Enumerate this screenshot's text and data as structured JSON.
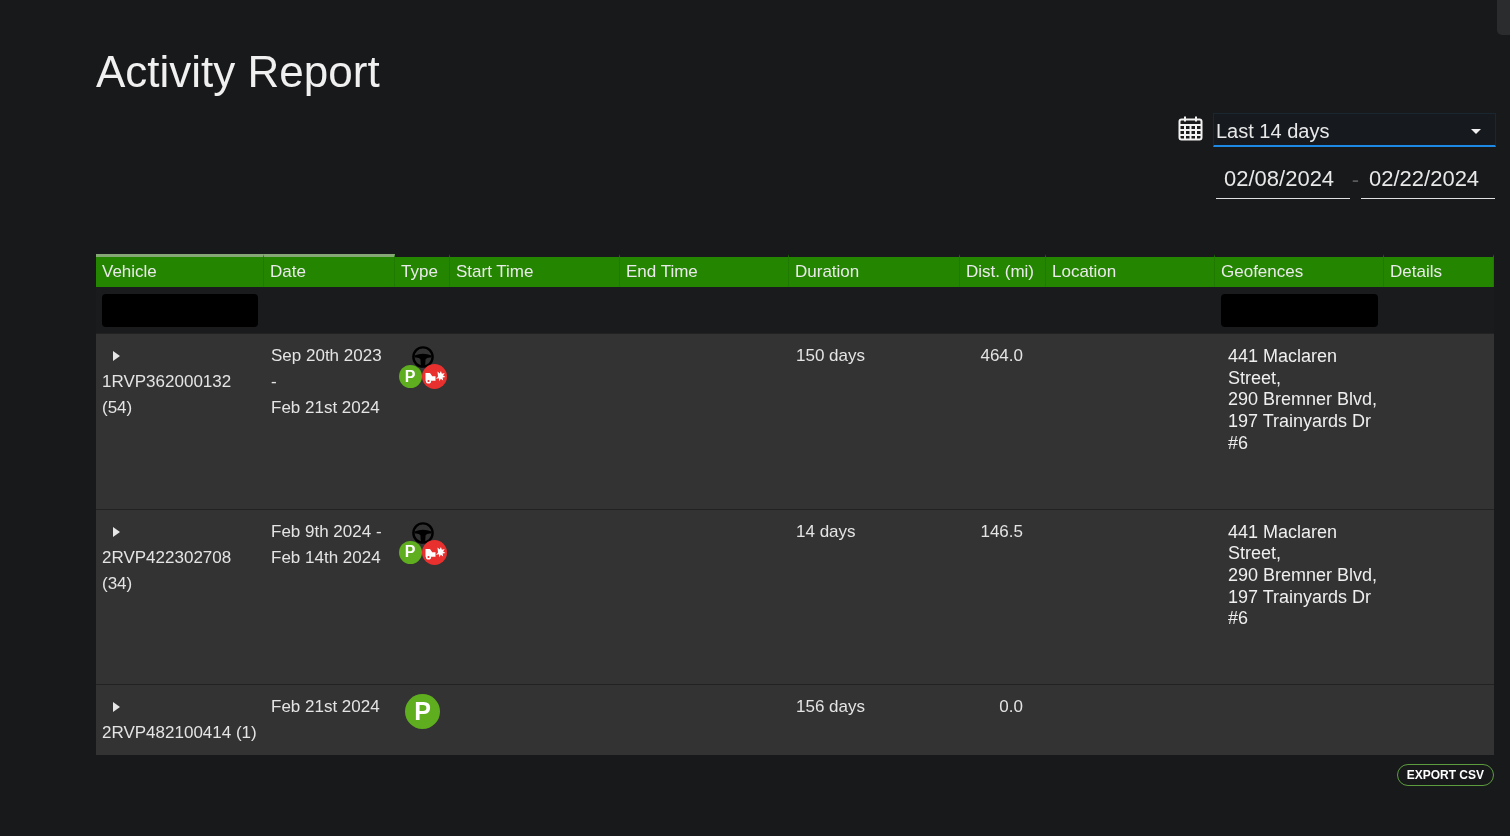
{
  "page": {
    "title": "Activity Report"
  },
  "date_range": {
    "preset": "Last 14 days",
    "start": "02/08/2024",
    "separator": "-",
    "end": "02/22/2024"
  },
  "table": {
    "columns": [
      {
        "label": "Vehicle",
        "sorted": true,
        "filter": true
      },
      {
        "label": "Date",
        "sorted": true,
        "filter": false
      },
      {
        "label": "Type",
        "sorted": false,
        "filter": false
      },
      {
        "label": "Start Time",
        "sorted": false,
        "filter": false
      },
      {
        "label": "End Time",
        "sorted": false,
        "filter": false
      },
      {
        "label": "Duration",
        "sorted": false,
        "filter": false
      },
      {
        "label": "Dist. (mi)",
        "sorted": false,
        "filter": false
      },
      {
        "label": "Location",
        "sorted": false,
        "filter": false
      },
      {
        "label": "Geofences",
        "sorted": false,
        "filter": true
      },
      {
        "label": "Details",
        "sorted": false,
        "filter": false
      }
    ],
    "rows": [
      {
        "expanded": false,
        "vehicle": "1RVP362000132 (54)",
        "date": [
          "Sep 20th 2023 -",
          "Feb 21st 2024"
        ],
        "types": [
          {
            "kind": "steering_wheel"
          },
          {
            "kind": "parking",
            "label": "P"
          },
          {
            "kind": "collision"
          }
        ],
        "duration": "150 days",
        "distance": "464.0",
        "geofences": [
          "441 Maclaren Street,",
          "290 Bremner Blvd,",
          "197 Trainyards Dr #6"
        ]
      },
      {
        "expanded": false,
        "vehicle": "2RVP422302708 (34)",
        "date": [
          "Feb 9th 2024 -",
          "Feb 14th 2024"
        ],
        "types": [
          {
            "kind": "steering_wheel"
          },
          {
            "kind": "parking",
            "label": "P"
          },
          {
            "kind": "collision"
          }
        ],
        "duration": "14 days",
        "distance": "146.5",
        "geofences": [
          "441 Maclaren Street,",
          "290 Bremner Blvd,",
          "197 Trainyards Dr #6"
        ]
      },
      {
        "expanded": false,
        "vehicle": "2RVP482100414 (1)",
        "date": [
          "Feb 21st 2024"
        ],
        "types": [
          {
            "kind": "parking",
            "label": "P"
          }
        ],
        "duration": "156 days",
        "distance": "0.0"
      }
    ]
  },
  "export_button": "EXPORT CSV"
}
